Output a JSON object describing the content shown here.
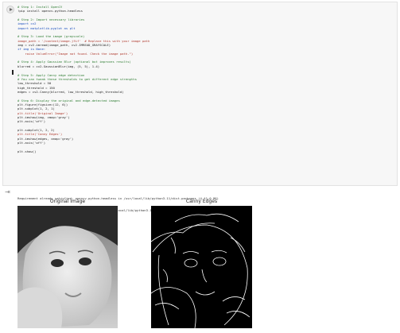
{
  "code_lines": [
    {
      "t": "# Step 1: Install OpenCV",
      "k": "comment"
    },
    {
      "t": "!pip install opencv-python-headless",
      "k": "plain"
    },
    {
      "t": "",
      "k": "plain"
    },
    {
      "t": "# Step 2: Import necessary libraries",
      "k": "comment"
    },
    {
      "t": "import cv2",
      "k": "kw"
    },
    {
      "t": "import matplotlib.pyplot as plt",
      "k": "kw"
    },
    {
      "t": "",
      "k": "plain"
    },
    {
      "t": "# Step 3: Load the image (grayscale)",
      "k": "comment"
    },
    {
      "t": "image_path = '/content/image.jfif'  # Replace this with your image path",
      "k": "str"
    },
    {
      "t": "img = cv2.imread(image_path, cv2.IMREAD_GRAYSCALE)",
      "k": "plain"
    },
    {
      "t": "if img is None:",
      "k": "kw"
    },
    {
      "t": "    raise ValueError(\"Image not found. Check the image path.\")",
      "k": "str"
    },
    {
      "t": "",
      "k": "plain"
    },
    {
      "t": "# Step 4: Apply Gaussian Blur (optional but improves results)",
      "k": "comment"
    },
    {
      "t": "blurred = cv2.GaussianBlur(img, (5, 5), 1.4)",
      "k": "plain"
    },
    {
      "t": "",
      "k": "plain"
    },
    {
      "t": "# Step 5: Apply Canny edge detection",
      "k": "comment"
    },
    {
      "t": "# You can tweak these thresholds to get different edge strengths",
      "k": "comment"
    },
    {
      "t": "low_threshold = 50",
      "k": "plain"
    },
    {
      "t": "high_threshold = 150",
      "k": "plain"
    },
    {
      "t": "edges = cv2.Canny(blurred, low_threshold, high_threshold)",
      "k": "plain"
    },
    {
      "t": "",
      "k": "plain"
    },
    {
      "t": "# Step 6: Display the original and edge-detected images",
      "k": "comment"
    },
    {
      "t": "plt.figure(figsize=(12, 6))",
      "k": "plain"
    },
    {
      "t": "plt.subplot(1, 2, 1)",
      "k": "plain"
    },
    {
      "t": "plt.title('Original Image')",
      "k": "str"
    },
    {
      "t": "plt.imshow(img, cmap='gray')",
      "k": "plain"
    },
    {
      "t": "plt.axis('off')",
      "k": "plain"
    },
    {
      "t": "",
      "k": "plain"
    },
    {
      "t": "plt.subplot(1, 2, 2)",
      "k": "plain"
    },
    {
      "t": "plt.title('Canny Edges')",
      "k": "str"
    },
    {
      "t": "plt.imshow(edges, cmap='gray')",
      "k": "plain"
    },
    {
      "t": "plt.axis('off')",
      "k": "plain"
    },
    {
      "t": "",
      "k": "plain"
    },
    {
      "t": "plt.show()",
      "k": "plain"
    }
  ],
  "output": {
    "line1": "Requirement already satisfied: opencv-python-headless in /usr/local/lib/python3.11/dist-packages (4.11.0.86)",
    "line2": "Requirement already satisfied: numpy>=1.21.2 in /usr/local/lib/python3.11/dist-packages (from opencv-python-headless) (2.0.2)"
  },
  "figure": {
    "title_left": "Original Image",
    "title_right": "Canny Edges"
  },
  "colors": {
    "comment": "#2e7d32",
    "keyword": "#1a4fbf",
    "string": "#b03a2e"
  }
}
